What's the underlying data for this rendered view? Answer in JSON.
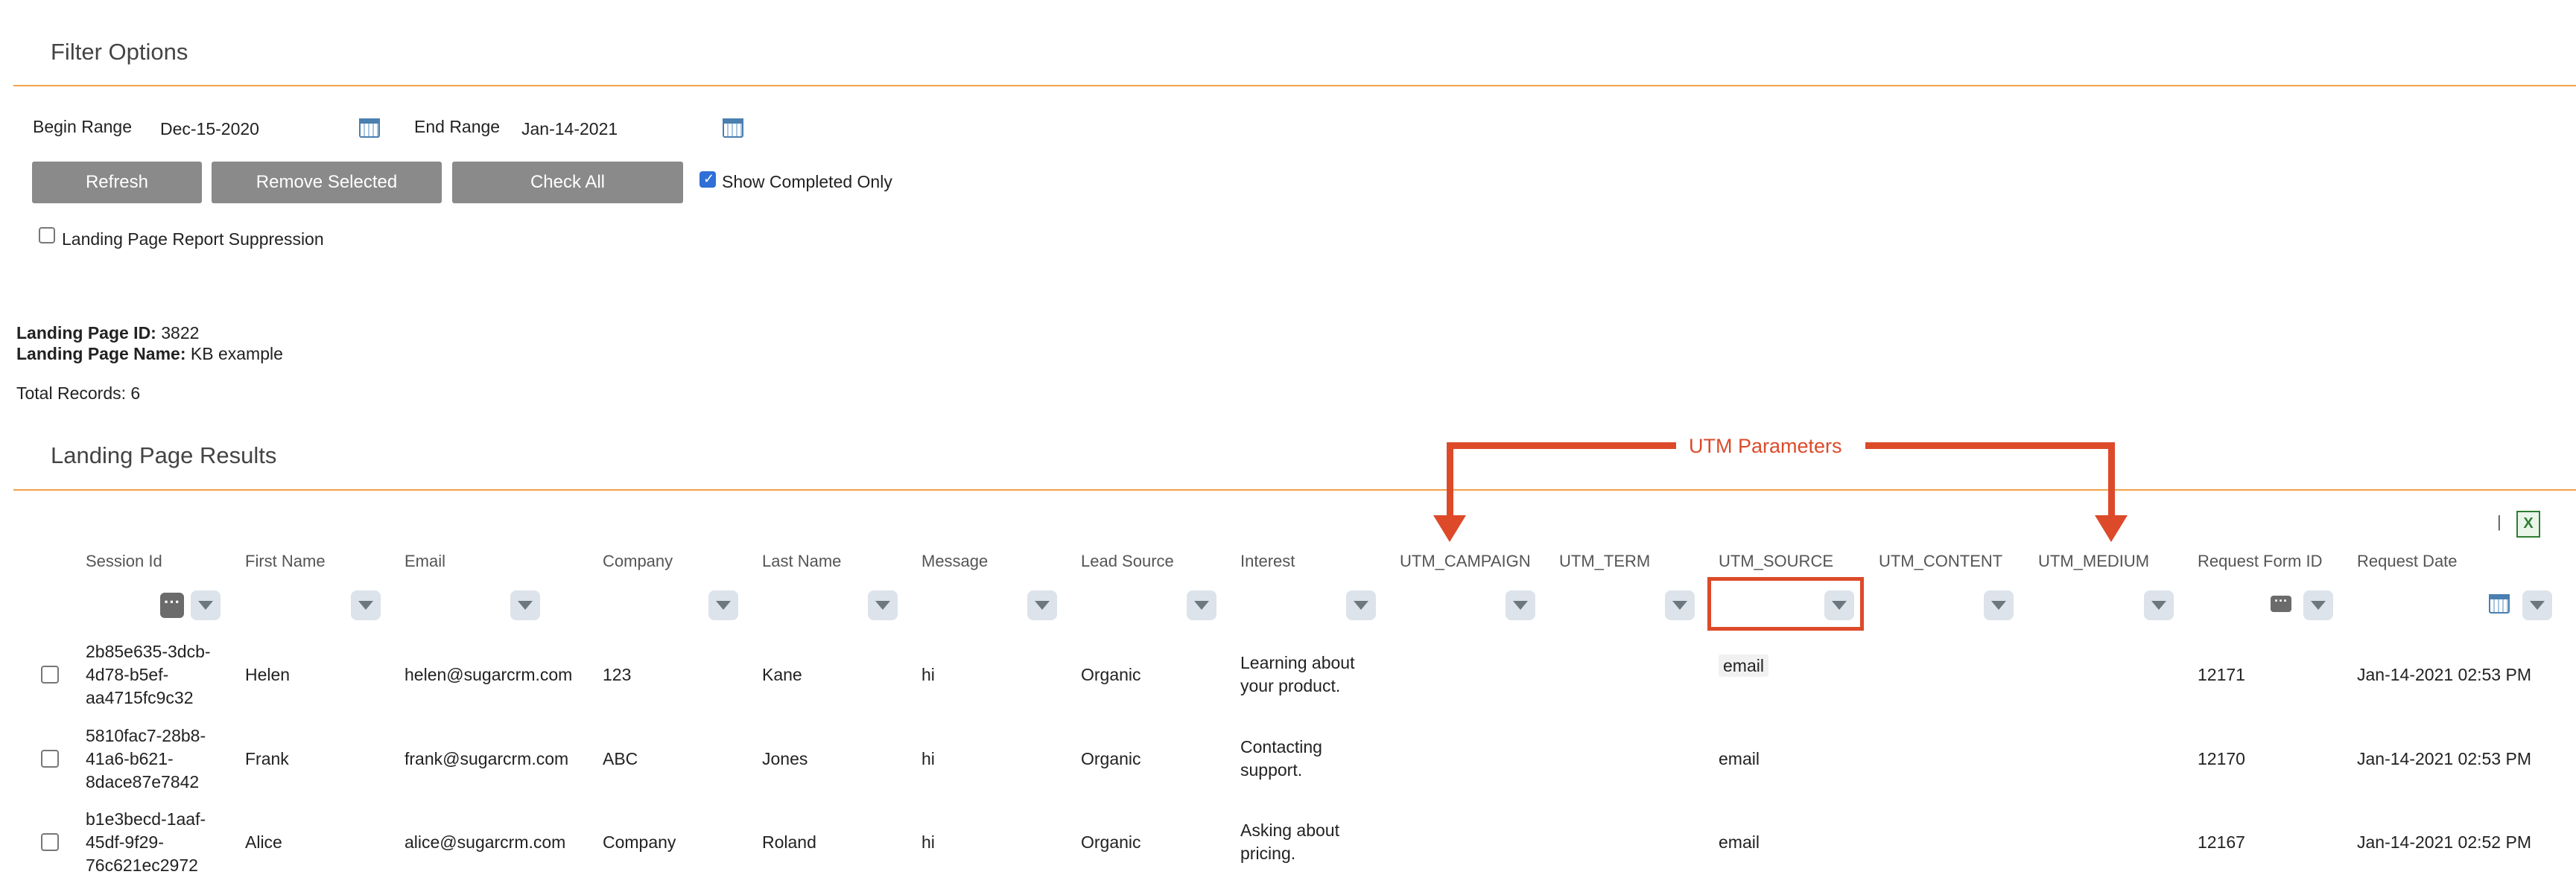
{
  "filter": {
    "title": "Filter Options",
    "begin_label": "Begin Range",
    "begin_value": "Dec-15-2020",
    "end_label": "End Range",
    "end_value": "Jan-14-2021",
    "buttons": {
      "refresh": "Refresh",
      "remove_selected": "Remove Selected",
      "check_all": "Check All"
    },
    "show_completed_label": "Show Completed Only",
    "show_completed_checked": true,
    "suppression_label": "Landing Page Report Suppression",
    "suppression_checked": false
  },
  "info": {
    "id_label": "Landing Page ID:",
    "id_value": "3822",
    "name_label": "Landing Page Name:",
    "name_value": "KB example",
    "total_records": "Total Records: 6"
  },
  "results": {
    "title": "Landing Page Results",
    "columns": [
      "Session Id",
      "First Name",
      "Email",
      "Company",
      "Last Name",
      "Message",
      "Lead Source",
      "Interest",
      "UTM_CAMPAIGN",
      "UTM_TERM",
      "UTM_SOURCE",
      "UTM_CONTENT",
      "UTM_MEDIUM",
      "Request Form ID",
      "Request Date"
    ],
    "rows": [
      {
        "session": [
          "2b85e635-3dcb-",
          "4d78-b5ef-",
          "aa4715fc9c32"
        ],
        "first": "Helen",
        "email": "helen@sugarcrm.com",
        "company": "123",
        "last": "Kane",
        "message": "hi",
        "lead_source": "Organic",
        "interest": [
          "Learning about",
          "your product."
        ],
        "utm_source": "email",
        "form_id": "12171",
        "date": "Jan-14-2021 02:53 PM"
      },
      {
        "session": [
          "5810fac7-28b8-",
          "41a6-b621-",
          "8dace87e7842"
        ],
        "first": "Frank",
        "email": "frank@sugarcrm.com",
        "company": "ABC",
        "last": "Jones",
        "message": "hi",
        "lead_source": "Organic",
        "interest": [
          "Contacting",
          "support."
        ],
        "utm_source": "email",
        "form_id": "12170",
        "date": "Jan-14-2021 02:53 PM"
      },
      {
        "session": [
          "b1e3becd-1aaf-",
          "45df-9f29-",
          "76c621ec2972"
        ],
        "first": "Alice",
        "email": "alice@sugarcrm.com",
        "company": "Company",
        "last": "Roland",
        "message": "hi",
        "lead_source": "Organic",
        "interest": [
          "Asking about",
          "pricing."
        ],
        "utm_source": "email",
        "form_id": "12167",
        "date": "Jan-14-2021 02:52 PM"
      }
    ]
  },
  "annotation": {
    "label": "UTM Parameters",
    "color": "#dc4a2a"
  },
  "toolbar": {
    "separator": "|",
    "excel_icon": "excel-export-icon"
  },
  "colors": {
    "accent_rule": "#f0a04b",
    "button": "#8a8a8a",
    "highlight": "#dc4a2a"
  }
}
